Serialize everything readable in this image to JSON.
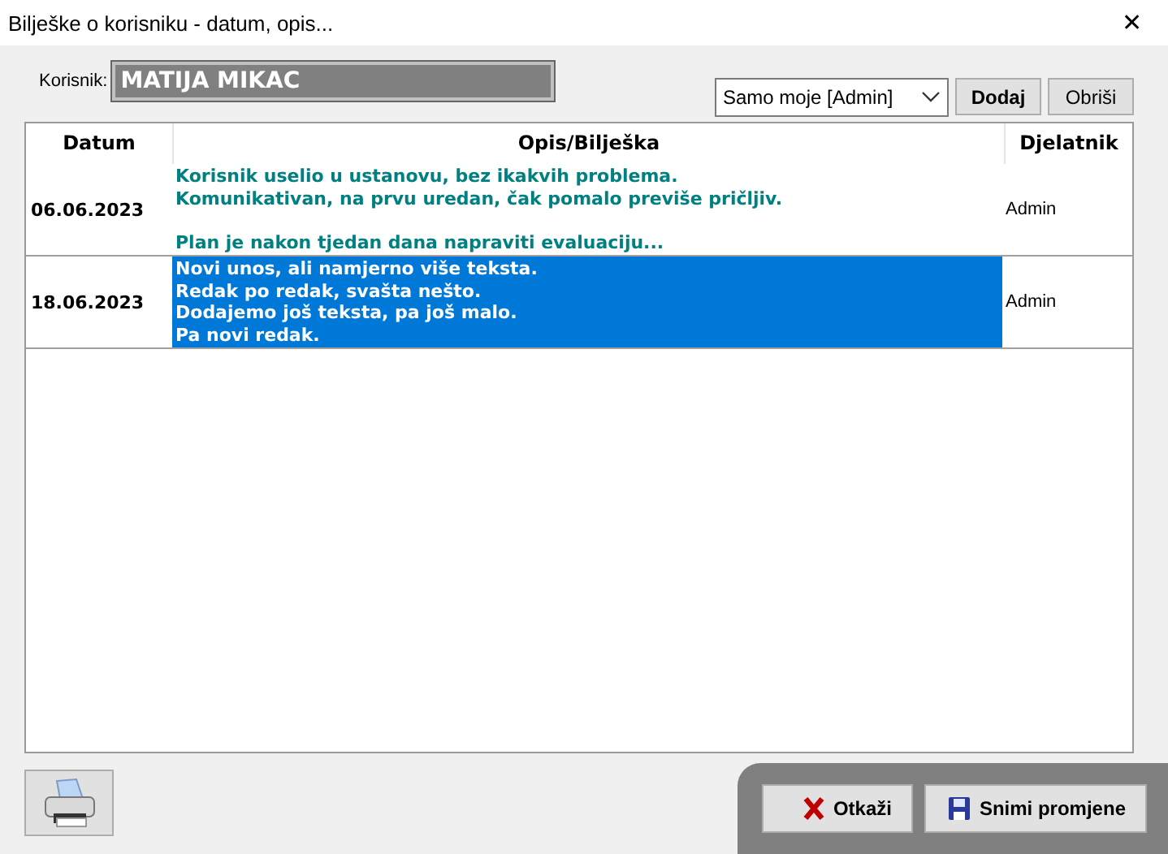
{
  "window": {
    "title": "Bilješke o korisniku - datum, opis...",
    "close": "✕"
  },
  "user": {
    "label": "Korisnik:",
    "value": "MATIJA MIKAC"
  },
  "filter": {
    "value": "Samo moje [Admin]"
  },
  "buttons": [
    {
      "label": "Dodaj",
      "bold": true
    },
    {
      "label": "Obriši",
      "bold": false
    }
  ],
  "table": {
    "columns": [
      "Datum",
      "Opis/Bilješka",
      "Djelatnik"
    ],
    "rows": [
      {
        "date": "06.06.2023",
        "note": "Korisnik uselio u ustanovu, bez ikakvih problema.\nKomunikativan, na prvu uredan, čak pomalo previše pričljiv.\n\nPlan je nakon tjedan dana napraviti evaluaciju...",
        "worker": "Admin",
        "selected": false
      },
      {
        "date": "18.06.2023",
        "note": "Novi unos, ali namjerno više teksta.\nRedak po redak, svašta nešto.\nDodajemo još teksta, pa još malo.\nPa novi redak.",
        "worker": "Admin",
        "selected": true
      }
    ]
  },
  "footer": {
    "cancel": "Otkaži",
    "save": "Snimi promjene"
  }
}
